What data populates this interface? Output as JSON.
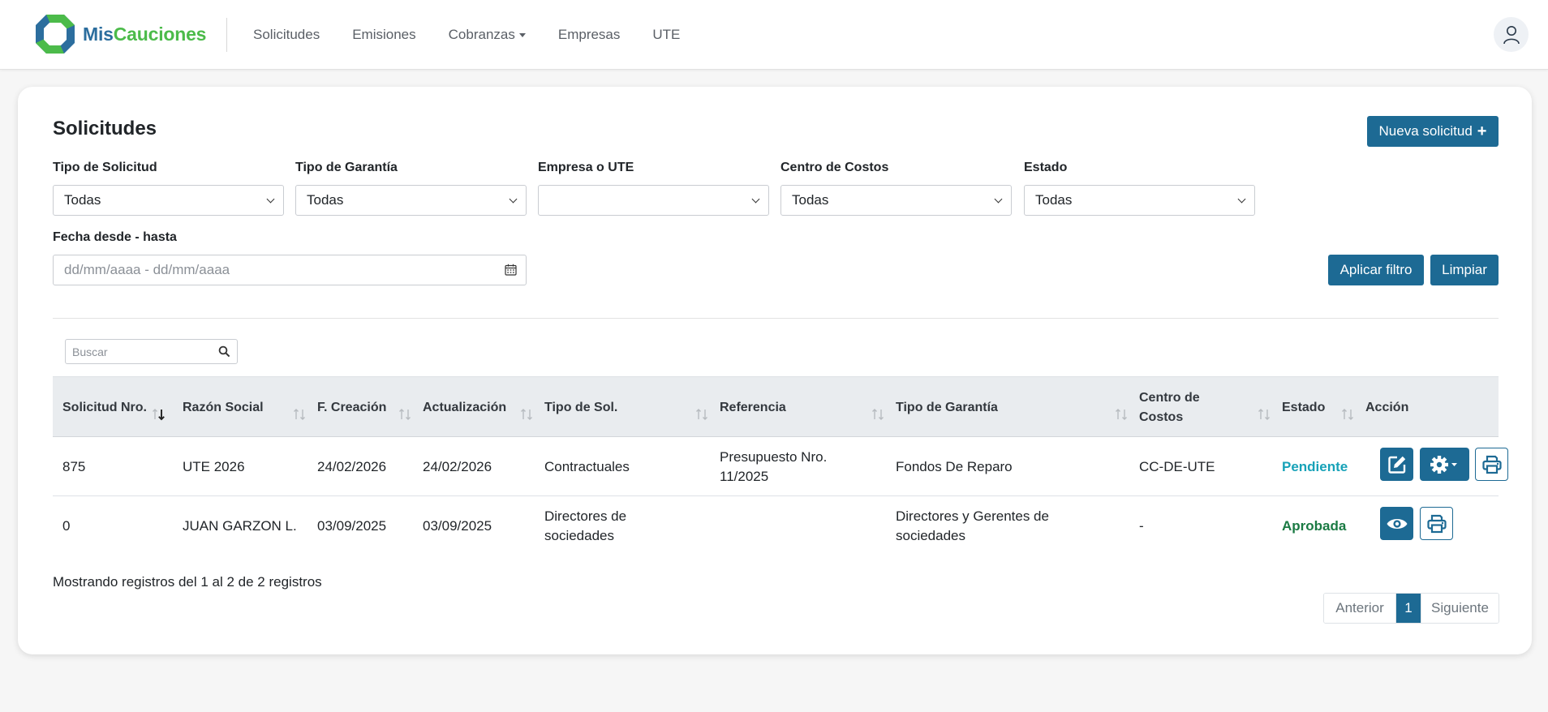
{
  "brand": {
    "part1": "Mis",
    "part2": "Cauciones",
    "primary": "#2c6e9e",
    "accent": "#4cbb4a"
  },
  "nav": {
    "items": [
      {
        "label": "Solicitudes"
      },
      {
        "label": "Emisiones"
      },
      {
        "label": "Cobranzas",
        "dropdown": true
      },
      {
        "label": "Empresas"
      },
      {
        "label": "UTE"
      }
    ],
    "user_icon": "user-icon"
  },
  "page": {
    "title": "Solicitudes",
    "new_button": "Nueva solicitud",
    "new_button_icon": "plus-icon"
  },
  "filters": {
    "tipo_solicitud": {
      "label": "Tipo de Solicitud",
      "value": "Todas"
    },
    "tipo_garantia": {
      "label": "Tipo de Garantía",
      "value": "Todas"
    },
    "empresa_ute": {
      "label": "Empresa o UTE",
      "value": ""
    },
    "centro_costos": {
      "label": "Centro de Costos",
      "value": "Todas"
    },
    "estado": {
      "label": "Estado",
      "value": "Todas"
    },
    "fecha": {
      "label": "Fecha desde - hasta",
      "placeholder": "dd/mm/aaaa - dd/mm/aaaa"
    },
    "apply_label": "Aplicar filtro",
    "clear_label": "Limpiar"
  },
  "search": {
    "placeholder": "Buscar"
  },
  "table": {
    "columns": [
      {
        "label": "Solicitud Nro.",
        "sort": "desc"
      },
      {
        "label": "Razón Social",
        "sort": "none"
      },
      {
        "label": "F. Creación",
        "sort": "none"
      },
      {
        "label": "Actualización",
        "sort": "none"
      },
      {
        "label": "Tipo de Sol.",
        "sort": "none"
      },
      {
        "label": "Referencia",
        "sort": "none"
      },
      {
        "label": "Tipo de Garantía",
        "sort": "none"
      },
      {
        "label": "Centro de Costos",
        "sort": "none"
      },
      {
        "label": "Estado",
        "sort": "none"
      },
      {
        "label": "Acción"
      }
    ],
    "rows": [
      {
        "nro": "875",
        "razon": "UTE 2026",
        "creacion": "24/02/2026",
        "actualizacion": "24/02/2026",
        "tipo_sol": "Contractuales",
        "referencia": "Presupuesto Nro. 11/2025",
        "garantia": "Fondos De Reparo",
        "centro": "CC-DE-UTE",
        "estado": "Pendiente",
        "estado_color": "#17a2b8",
        "actions": [
          "edit-icon",
          "gear-icon",
          "print-icon"
        ]
      },
      {
        "nro": "0",
        "razon": "JUAN GARZON L.",
        "creacion": "03/09/2025",
        "actualizacion": "03/09/2025",
        "tipo_sol": "Directores de sociedades",
        "referencia": "",
        "garantia": "Directores y Gerentes de sociedades",
        "centro": "-",
        "estado": "Aprobada",
        "estado_color": "#1a7a43",
        "actions": [
          "eye-icon",
          "print-icon"
        ]
      }
    ]
  },
  "footer": {
    "info": "Mostrando registros del 1 al 2 de 2 registros",
    "prev": "Anterior",
    "page": "1",
    "next": "Siguiente"
  },
  "colors": {
    "button": "#1d6a94",
    "header_bg": "#e9ecef",
    "page_bg": "#f6f6f6"
  }
}
